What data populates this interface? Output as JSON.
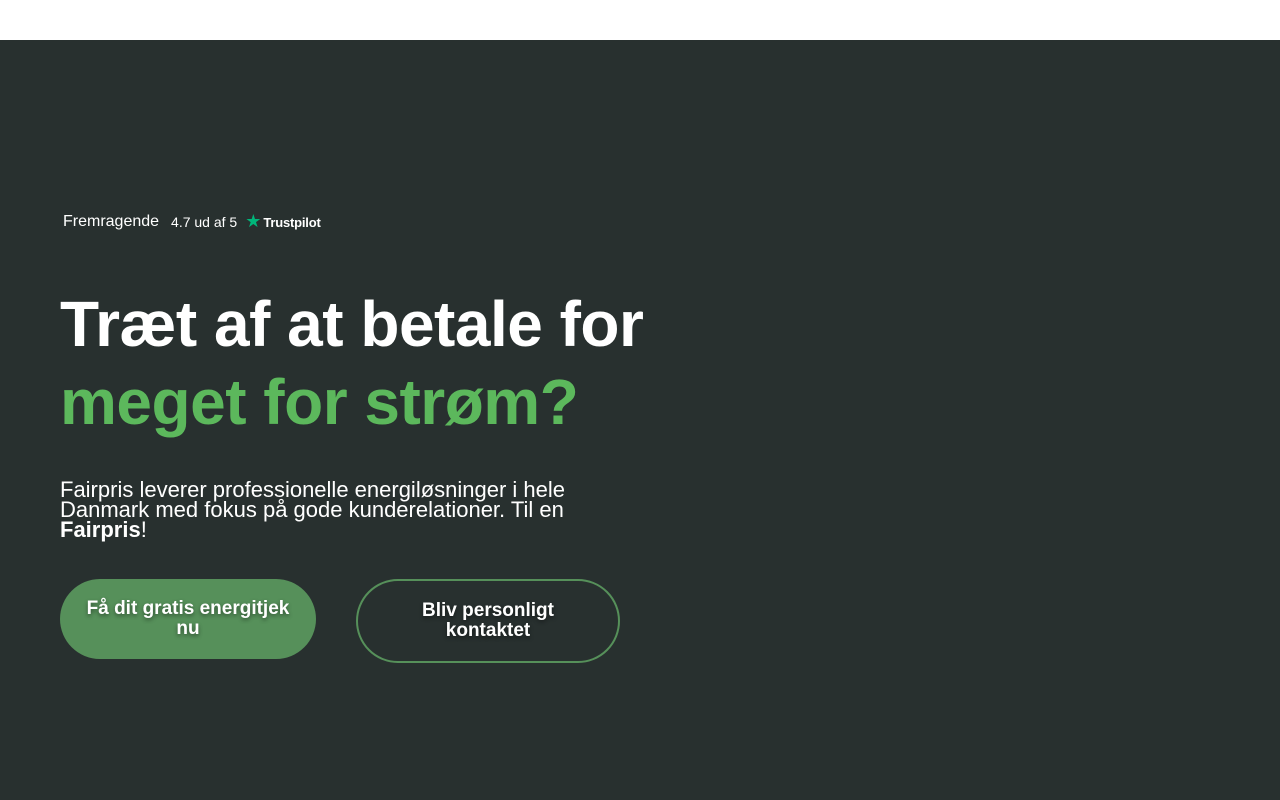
{
  "trustpilot": {
    "label": "Fremragende",
    "score_text": "4.7 ud af 5",
    "star_icon": "trustpilot-star-icon",
    "brand": "Trustpilot",
    "star_color": "#00b67a"
  },
  "hero": {
    "headline_line1": "Træt af at betale for",
    "headline_line2": "meget for strøm?",
    "lead_text": "Fairpris leverer professionelle energiløsninger i hele Danmark med fokus på gode kunderelationer. Til en ",
    "lead_brand": "Fairpris",
    "lead_end": "!"
  },
  "buttons": {
    "primary_label": "Få dit gratis energitjek nu",
    "secondary_label": "Bliv personligt kontaktet"
  },
  "colors": {
    "background": "#28302f",
    "accent_green": "#5cb85c",
    "button_green": "#56905a"
  }
}
